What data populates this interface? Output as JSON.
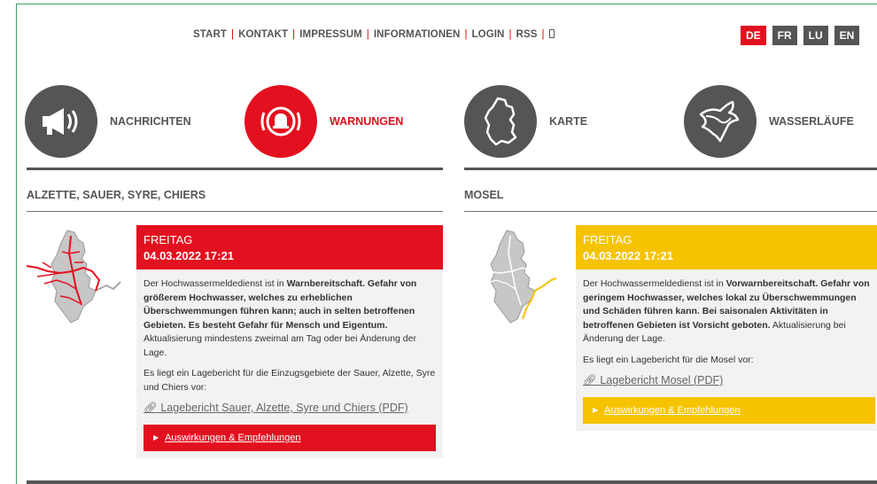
{
  "topnav": {
    "items": [
      "START",
      "KONTAKT",
      "IMPRESSUM",
      "INFORMATIONEN",
      "LOGIN",
      "RSS"
    ]
  },
  "languages": {
    "items": [
      "DE",
      "FR",
      "LU",
      "EN"
    ],
    "active": "DE"
  },
  "nav": {
    "nachrichten": "NACHRICHTEN",
    "warnungen": "WARNUNGEN",
    "karte": "KARTE",
    "wasserlaeufe": "WASSERLÄUFE"
  },
  "colors": {
    "red": "#e3101f",
    "yellow": "#f5c300",
    "gray": "#555555"
  },
  "left": {
    "title": "ALZETTE, SAUER, SYRE, CHIERS",
    "day": "FREITAG",
    "date": "04.03.2022 17:21",
    "text1_a": "Der Hochwassermeldedienst ist in ",
    "text1_b": "Warnbereitschaft. Gefahr von größerem Hochwasser, welches zu erheblichen Überschwemmungen führen kann; auch in selten betroffenen Gebieten. Es besteht Gefahr für Mensch und Eigentum.",
    "text1_c": " Aktualisierung mindestens zweimal am Tag oder bei Änderung der Lage.",
    "text2": "Es liegt ein Lagebericht für die Einzugsgebiete der Sauer, Alzette, Syre und Chiers vor:",
    "report": "Lagebericht Sauer, Alzette, Syre und Chiers (PDF)",
    "button": "Auswirkungen & Empfehlungen"
  },
  "right": {
    "title": "MOSEL",
    "day": "FREITAG",
    "date": "04.03.2022 17:21",
    "text1_a": "Der Hochwassermeldedienst ist in ",
    "text1_b": "Vorwarnbereitschaft. Gefahr von geringem Hochwasser, welches lokal zu Überschwemmungen und Schäden führen kann. Bei saisonalen Aktivitäten in betroffenen Gebieten ist Vorsicht geboten.",
    "text1_c": " Aktualisierung bei Änderung der Lage.",
    "text2": "Es liegt ein Lagebericht für die Mosel vor:",
    "report": "Lagebericht Mosel (PDF)",
    "button": "Auswirkungen & Empfehlungen"
  }
}
